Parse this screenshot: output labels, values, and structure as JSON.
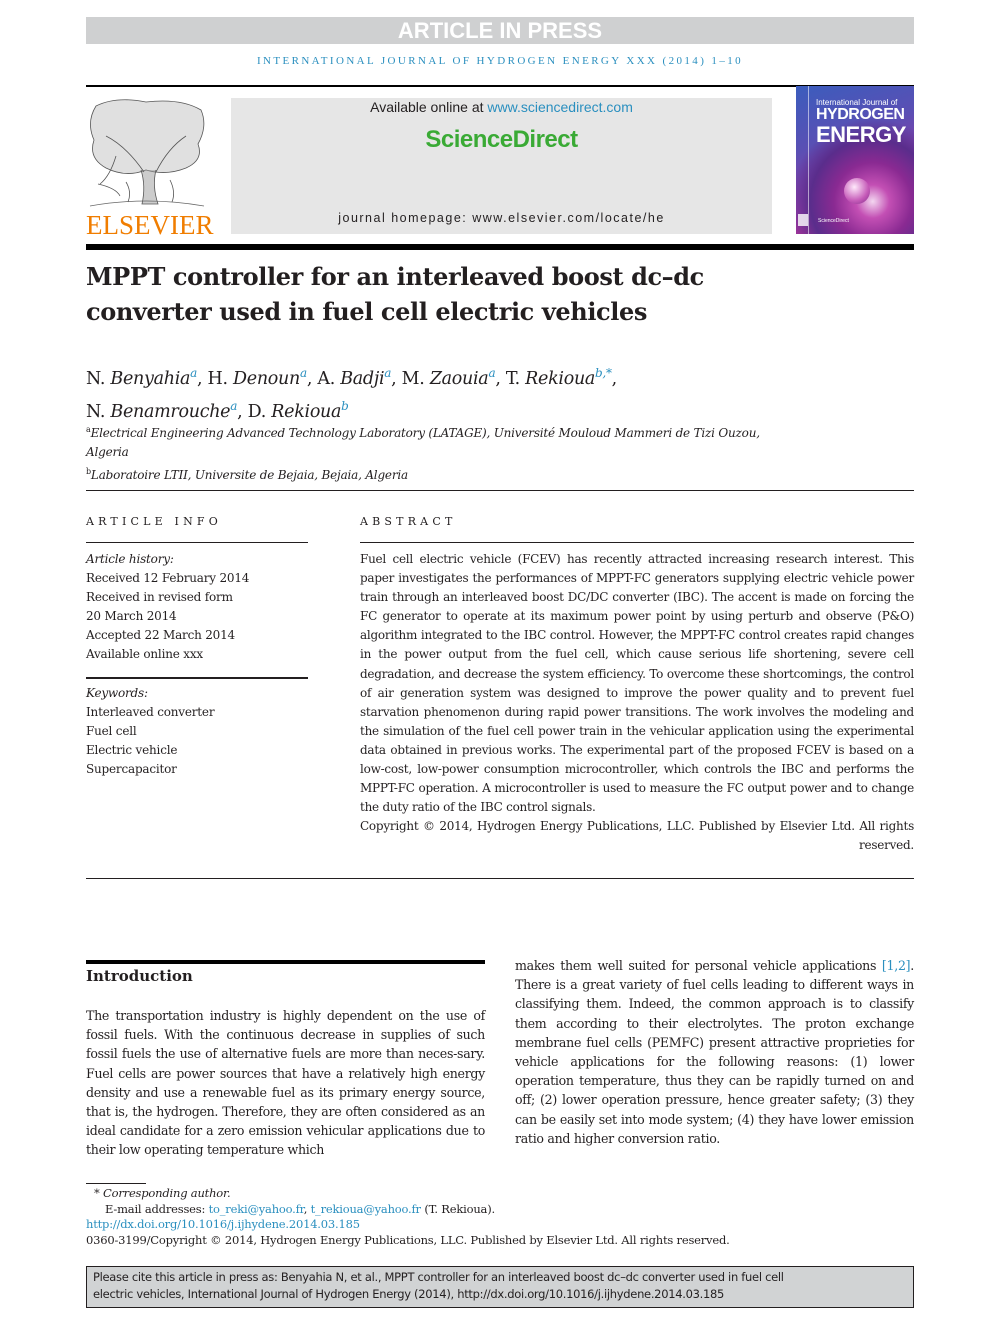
{
  "banner": "ARTICLE IN PRESS",
  "journal_running_head": "INTERNATIONAL JOURNAL OF HYDROGEN ENERGY XXX (2014) 1–10",
  "header": {
    "publisher_logo": "ELSEVIER",
    "available_online_prefix": "Available online at ",
    "available_online_link": "www.sciencedirect.com",
    "platform_logo": "ScienceDirect",
    "homepage_label": "journal homepage: www.elsevier.com/locate/he",
    "cover": {
      "line1": "International Journal of",
      "line2": "HYDROGEN",
      "line3": "ENERGY",
      "footer": "ScienceDirect"
    },
    "colors": {
      "link": "#2a8fbf",
      "sciencedirect_green": "#3aaa35",
      "elsevier_orange": "#f07d00",
      "banner_gray": "#cfd0d1"
    }
  },
  "article": {
    "title_line1": "MPPT controller for an interleaved boost dc–dc",
    "title_line2": "converter used in fuel cell electric vehicles",
    "authors": [
      {
        "initial": "N. ",
        "surname": "Benyahia",
        "aff": "a"
      },
      {
        "initial": "H. ",
        "surname": "Denoun",
        "aff": "a"
      },
      {
        "initial": "A. ",
        "surname": "Badji",
        "aff": "a"
      },
      {
        "initial": "M. ",
        "surname": "Zaouia",
        "aff": "a"
      },
      {
        "initial": "T. ",
        "surname": "Rekioua",
        "aff": "b,*"
      },
      {
        "initial": "N. ",
        "surname": "Benamrouche",
        "aff": "a"
      },
      {
        "initial": "D. ",
        "surname": "Rekioua",
        "aff": "b"
      }
    ],
    "affiliations": [
      {
        "label": "a",
        "line1": "Electrical Engineering Advanced Technology Laboratory (LATAGE), Université Mouloud Mammeri de Tizi Ouzou,",
        "line2": "Algeria"
      },
      {
        "label": "b",
        "line1": "Laboratoire LTII, Universite de Bejaia, Bejaia, Algeria"
      }
    ]
  },
  "article_info": {
    "heading": "ARTICLE INFO",
    "history_label": "Article history:",
    "history": [
      "Received 12 February 2014",
      "Received in revised form",
      "20 March 2014",
      "Accepted 22 March 2014",
      "Available online xxx"
    ],
    "keywords_label": "Keywords:",
    "keywords": [
      "Interleaved converter",
      "Fuel cell",
      "Electric vehicle",
      "Supercapacitor"
    ]
  },
  "abstract": {
    "heading": "ABSTRACT",
    "body": "Fuel cell electric vehicle (FCEV) has recently attracted increasing research interest. This paper investigates the performances of MPPT-FC generators supplying electric vehicle power train through an interleaved boost DC/DC converter (IBC). The accent is made on forcing the FC generator to operate at its maximum power point by using perturb and observe (P&O) algorithm integrated to the IBC control. However, the MPPT-FC control creates rapid changes in the power output from the fuel cell, which cause serious life shortening, severe cell degradation, and decrease the system efficiency. To overcome these shortcomings, the control of air generation system was designed to improve the power quality and to prevent fuel starvation phenomenon during rapid power transitions. The work involves the modeling and the simulation of the fuel cell power train in the vehicular application using the experimental data obtained in previous works. The experimental part of the proposed FCEV is based on a low-cost, low-power consumption microcontroller, which controls the IBC and performs the MPPT-FC operation. A microcontroller is used to measure the FC output power and to change the duty ratio of the IBC control signals.",
    "copyright": "Copyright © 2014, Hydrogen Energy Publications, LLC. Published by Elsevier Ltd. All rights reserved."
  },
  "introduction": {
    "heading": "Introduction",
    "left_column": "The transportation industry is highly dependent on the use of fossil fuels. With the continuous decrease in supplies of such fossil fuels the use of alternative fuels are more than neces-sary. Fuel cells are power sources that have a relatively high energy density and use a renewable fuel as its primary energy source, that is, the hydrogen. Therefore, they are often considered as an ideal candidate for a zero emission vehicular applications due to their low operating temperature which",
    "right_column_start": "makes them well suited for personal vehicle applications ",
    "right_column_ref": "[1,2]",
    "right_column_rest": ". There is a great variety of fuel cells leading to different ways in classifying them. Indeed, the common approach is to classify them according to their electrolytes. The proton exchange membrane fuel cells (PEMFC) present attractive proprieties for vehicle applications for the following reasons: (1) lower operation temperature, thus they can be rapidly turned on and off; (2) lower operation pressure, hence greater safety; (3) they can be easily set into mode system; (4) they have lower emission ratio and higher conversion ratio."
  },
  "footnotes": {
    "corresponding_mark": "*",
    "corresponding_label": "Corresponding author.",
    "email_prefix": "E-mail addresses: ",
    "email1": "to_reki@yahoo.fr",
    "email_sep": ", ",
    "email2": "t_rekioua@yahoo.fr",
    "email_suffix": " (T. Rekioua).",
    "doi": "http://dx.doi.org/10.1016/j.ijhydene.2014.03.185",
    "issn_copyright": "0360-3199/Copyright © 2014, Hydrogen Energy Publications, LLC. Published by Elsevier Ltd. All rights reserved."
  },
  "cite_box": {
    "line1": "Please cite this article in press as: Benyahia N, et al., MPPT controller for an interleaved boost dc–dc converter used in fuel cell",
    "line2": "electric vehicles, International Journal of Hydrogen Energy (2014), http://dx.doi.org/10.1016/j.ijhydene.2014.03.185"
  }
}
